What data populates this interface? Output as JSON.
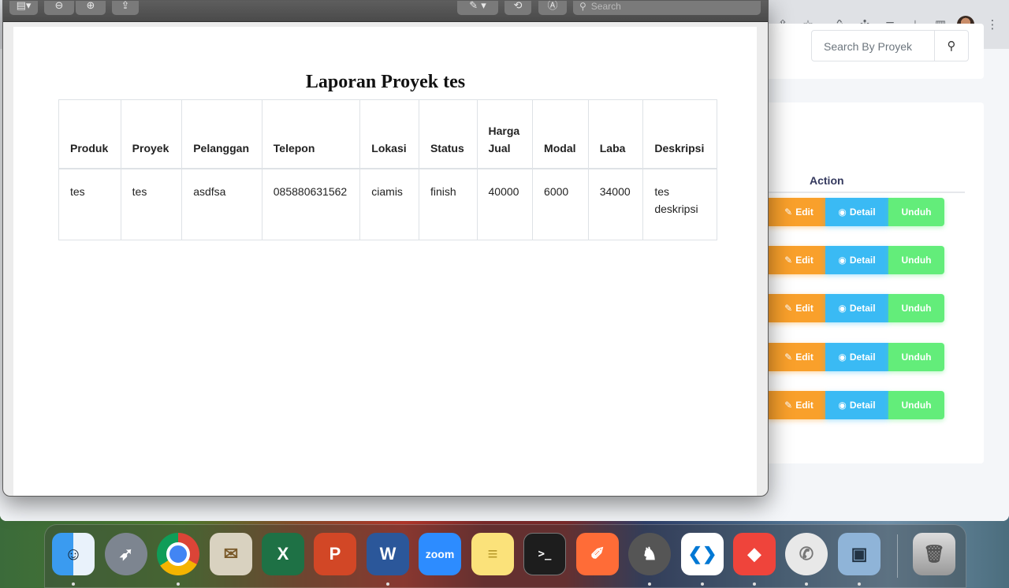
{
  "browser": {
    "search_placeholder": "Search By Proyek",
    "table_action_header": "Action",
    "rows": [
      {
        "edit": "Edit",
        "detail": "Detail",
        "unduh": "Unduh"
      },
      {
        "edit": "Edit",
        "detail": "Detail",
        "unduh": "Unduh"
      },
      {
        "edit": "Edit",
        "detail": "Detail",
        "unduh": "Unduh"
      },
      {
        "edit": "Edit",
        "detail": "Detail",
        "unduh": "Unduh"
      },
      {
        "edit": "Edit",
        "detail": "Detail",
        "unduh": "Unduh"
      }
    ]
  },
  "preview": {
    "search_placeholder": "Search",
    "report_title": "Laporan Proyek tes",
    "columns": [
      "Produk",
      "Proyek",
      "Pelanggan",
      "Telepon",
      "Lokasi",
      "Status",
      "Harga Jual",
      "Modal",
      "Laba",
      "Deskripsi"
    ],
    "row": [
      "tes",
      "tes",
      "asdfsa",
      "085880631562",
      "ciamis",
      "finish",
      "40000",
      "6000",
      "34000",
      "tes deskripsi"
    ]
  },
  "dock": {
    "apps": [
      "finder",
      "launchpad",
      "chrome",
      "mail",
      "excel",
      "powerpoint",
      "word",
      "zoom",
      "notes",
      "terminal",
      "postman",
      "mamp",
      "vscode",
      "anydesk",
      "whatsapp",
      "preview",
      "trash"
    ],
    "zoom_label": "zoom"
  }
}
